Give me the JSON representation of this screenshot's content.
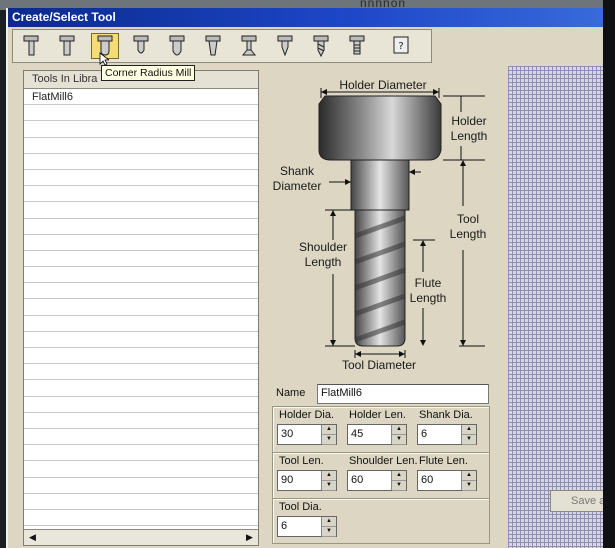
{
  "window": {
    "title": "Create/Select Tool",
    "ghost_text": "nnnnon"
  },
  "toolbar": {
    "buttons": [
      {
        "name": "Flat Mill",
        "icon": "flat-mill-icon"
      },
      {
        "name": "Flat Mill 2",
        "icon": "flat-mill-2-icon"
      },
      {
        "name": "Corner Radius Mill",
        "icon": "corner-radius-mill-icon",
        "active": true
      },
      {
        "name": "Ball Mill",
        "icon": "ball-mill-icon"
      },
      {
        "name": "Bull Mill",
        "icon": "bull-mill-icon"
      },
      {
        "name": "Taper Mill",
        "icon": "taper-mill-icon"
      },
      {
        "name": "Dovetail Mill",
        "icon": "dovetail-mill-icon"
      },
      {
        "name": "Engraving Tool",
        "icon": "engraving-tool-icon"
      },
      {
        "name": "Drill",
        "icon": "drill-icon"
      },
      {
        "name": "Tap",
        "icon": "tap-icon"
      },
      {
        "name": "Custom Tool",
        "icon": "custom-tool-icon"
      }
    ],
    "tooltip": "Corner Radius Mill"
  },
  "library": {
    "header": "Tools In Libra",
    "items": [
      "FlatMill6"
    ]
  },
  "diagram": {
    "holder_diameter": "Holder Diameter",
    "holder_length": "Holder\nLength",
    "shank_diameter": "Shank\nDiameter",
    "shoulder_length": "Shoulder\nLength",
    "tool_length": "Tool\nLength",
    "flute_length": "Flute\nLength",
    "tool_diameter": "Tool Diameter"
  },
  "name_field": {
    "label": "Name",
    "value": "FlatMill6"
  },
  "params": {
    "holder_dia": {
      "label": "Holder Dia.",
      "value": "30"
    },
    "holder_len": {
      "label": "Holder Len.",
      "value": "45"
    },
    "shank_dia": {
      "label": "Shank Dia.",
      "value": "6"
    },
    "tool_len": {
      "label": "Tool Len.",
      "value": "90"
    },
    "shoulder_len": {
      "label": "Shoulder Len.",
      "value": "60"
    },
    "flute_len": {
      "label": "Flute Len.",
      "value": "60"
    },
    "tool_dia": {
      "label": "Tool Dia.",
      "value": "6"
    }
  },
  "save_button": {
    "label": "Save as"
  }
}
